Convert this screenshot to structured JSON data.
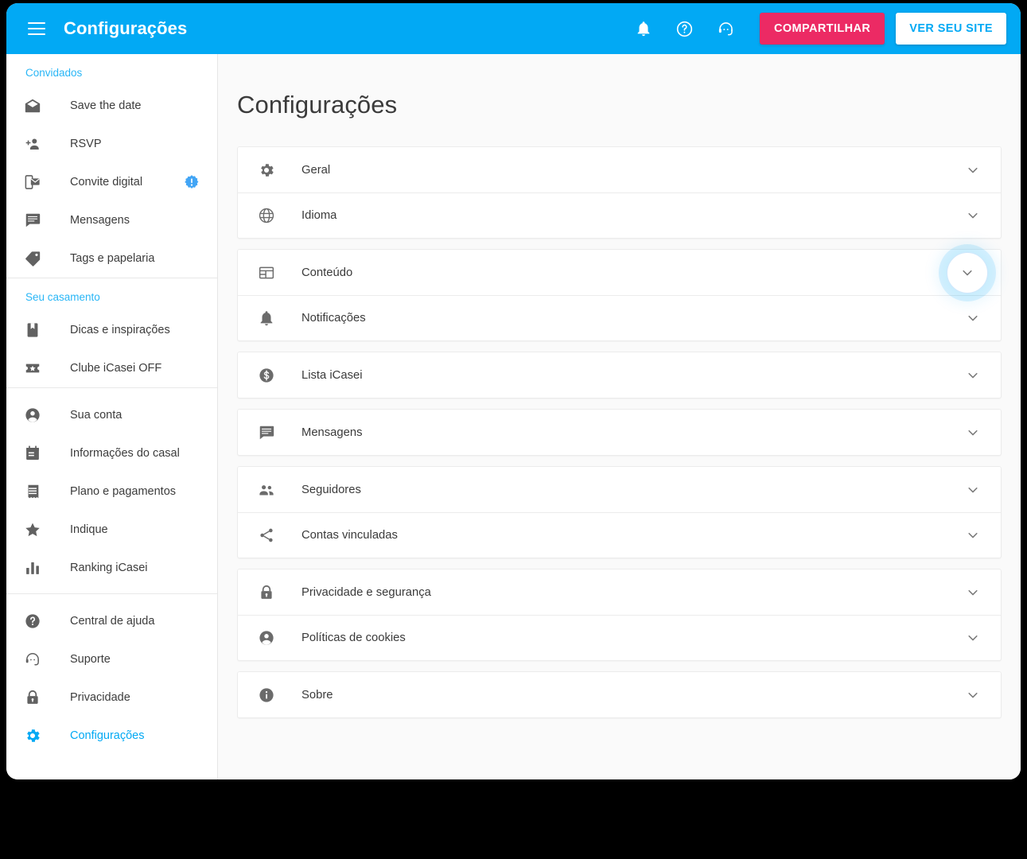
{
  "window": {
    "background": "#000000",
    "surface": "#fafafa"
  },
  "theme": {
    "primary": "#02a9f4",
    "accent_pink": "#ec2a64",
    "text": "#3a3a3a",
    "muted_icon": "#6b6b6b",
    "link": "#29b6f6"
  },
  "topbar": {
    "title": "Configurações",
    "menu_icon": "hamburger-icon",
    "icons": [
      {
        "name": "notifications-bell-icon",
        "glyph": "bell"
      },
      {
        "name": "help-circle-icon",
        "glyph": "help"
      },
      {
        "name": "support-agent-icon",
        "glyph": "support"
      }
    ],
    "share_label": "COMPARTILHAR",
    "view_site_label": "VER SEU SITE"
  },
  "sidebar": {
    "groups": [
      {
        "header": "Convidados",
        "items": [
          {
            "label": "Save the date",
            "icon": "mail-open-icon",
            "badge": null,
            "active": false
          },
          {
            "label": "RSVP",
            "icon": "person-add-icon",
            "badge": null,
            "active": false
          },
          {
            "label": "Convite digital",
            "icon": "digital-invite-icon",
            "badge": "alert-badge-icon",
            "active": false
          },
          {
            "label": "Mensagens",
            "icon": "chat-icon",
            "badge": null,
            "active": false
          },
          {
            "label": "Tags e papelaria",
            "icon": "tag-icon",
            "badge": null,
            "active": false
          }
        ]
      },
      {
        "header": "Seu casamento",
        "items": [
          {
            "label": "Dicas e inspirações",
            "icon": "bookmark-book-icon",
            "badge": null,
            "active": false
          },
          {
            "label": "Clube iCasei OFF",
            "icon": "ticket-star-icon",
            "badge": null,
            "active": false
          }
        ]
      },
      {
        "header": null,
        "items": [
          {
            "label": "Sua conta",
            "icon": "account-circle-icon",
            "badge": null,
            "active": false
          },
          {
            "label": "Informações do casal",
            "icon": "calendar-icon",
            "badge": null,
            "active": false
          },
          {
            "label": "Plano e pagamentos",
            "icon": "receipt-icon",
            "badge": null,
            "active": false
          },
          {
            "label": "Indique",
            "icon": "star-icon",
            "badge": null,
            "active": false
          },
          {
            "label": "Ranking iCasei",
            "icon": "bar-chart-icon",
            "badge": null,
            "active": false
          }
        ]
      },
      {
        "header": null,
        "items": [
          {
            "label": "Central de ajuda",
            "icon": "help-circle-icon",
            "badge": null,
            "active": false
          },
          {
            "label": "Suporte",
            "icon": "support-agent-icon",
            "badge": null,
            "active": false
          },
          {
            "label": "Privacidade",
            "icon": "lock-icon",
            "badge": null,
            "active": false
          },
          {
            "label": "Configurações",
            "icon": "gear-icon",
            "badge": null,
            "active": true
          }
        ]
      }
    ]
  },
  "main": {
    "page_title": "Configurações",
    "cards": [
      {
        "rows": [
          {
            "label": "Geral",
            "icon": "gear-icon",
            "chevron": "chevron-down-icon",
            "highlighted": false
          },
          {
            "label": "Idioma",
            "icon": "globe-icon",
            "chevron": "chevron-down-icon",
            "highlighted": false
          }
        ]
      },
      {
        "rows": [
          {
            "label": "Conteúdo",
            "icon": "web-layout-icon",
            "chevron": "chevron-down-icon",
            "highlighted": true
          },
          {
            "label": "Notificações",
            "icon": "bell-icon",
            "chevron": "chevron-down-icon",
            "highlighted": false
          }
        ]
      },
      {
        "rows": [
          {
            "label": "Lista iCasei",
            "icon": "money-circle-icon",
            "chevron": "chevron-down-icon",
            "highlighted": false
          }
        ]
      },
      {
        "rows": [
          {
            "label": "Mensagens",
            "icon": "chat-icon",
            "chevron": "chevron-down-icon",
            "highlighted": false
          }
        ]
      },
      {
        "rows": [
          {
            "label": "Seguidores",
            "icon": "people-icon",
            "chevron": "chevron-down-icon",
            "highlighted": false
          },
          {
            "label": "Contas vinculadas",
            "icon": "share-icon",
            "chevron": "chevron-down-icon",
            "highlighted": false
          }
        ]
      },
      {
        "rows": [
          {
            "label": "Privacidade e segurança",
            "icon": "lock-icon",
            "chevron": "chevron-down-icon",
            "highlighted": false
          },
          {
            "label": "Políticas de cookies",
            "icon": "account-circle-icon",
            "chevron": "chevron-down-icon",
            "highlighted": false
          }
        ]
      },
      {
        "rows": [
          {
            "label": "Sobre",
            "icon": "info-circle-icon",
            "chevron": "chevron-down-icon",
            "highlighted": false
          }
        ]
      }
    ]
  }
}
